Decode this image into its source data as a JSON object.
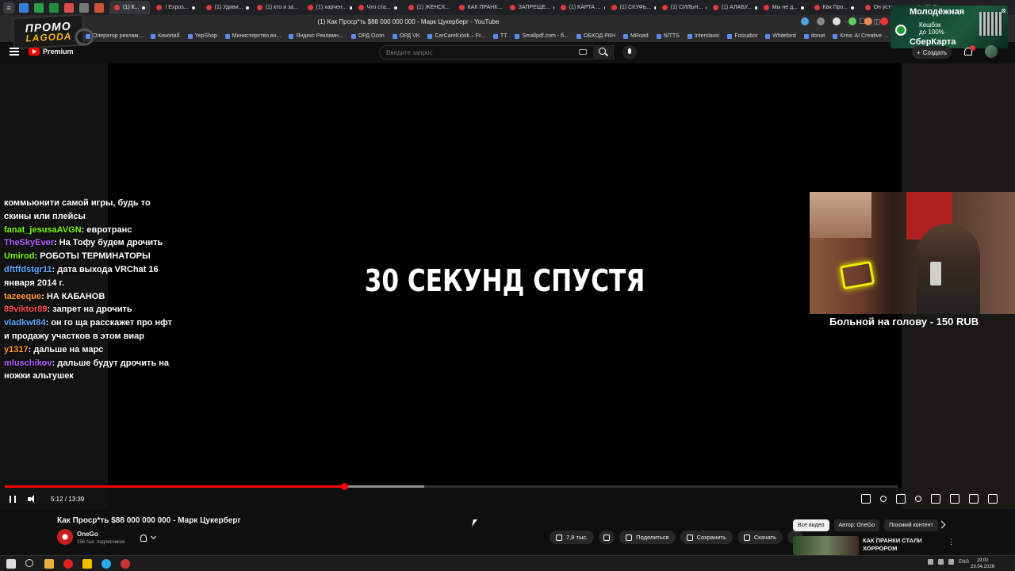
{
  "browser": {
    "window_title": "(1) Как Проср*ть $88 000 000 000 - Марк Цукерберг - YouTube",
    "tabs": [
      {
        "label": "(1) К...",
        "active": true
      },
      {
        "label": "! Expos...",
        "active": false
      },
      {
        "label": "(1) Удиви...",
        "active": false
      },
      {
        "label": "(1) кто и за...",
        "active": false
      },
      {
        "label": "(1) харчен...",
        "active": false
      },
      {
        "label": "Что ста...",
        "active": false
      },
      {
        "label": "(1) ЖЕНСК...",
        "active": false
      },
      {
        "label": "КАК ПРАНК...",
        "active": false
      },
      {
        "label": "ЗАПРЕЩЕ...",
        "active": false
      },
      {
        "label": "(1) КАРТА ...",
        "active": false
      },
      {
        "label": "(1) СКУФЬ...",
        "active": false
      },
      {
        "label": "(1) СИЛЬН...",
        "active": false
      },
      {
        "label": "(1) АЛАБУ...",
        "active": false
      },
      {
        "label": "Мы не д...",
        "active": false
      },
      {
        "label": "Как Про...",
        "active": false
      },
      {
        "label": "Он устр...",
        "active": false
      },
      {
        "label": "(1) Я стал...",
        "active": false
      }
    ],
    "bookmarks": [
      "Оператор реклам...",
      "Кинопаб",
      "YepShop",
      "Министерство вн...",
      "Яндекс Рекламн...",
      "ОРД Ozon",
      "ОРД VK",
      "CarCareKiosk – Fr...",
      "TT",
      "Smallpdf.com - б...",
      "ОБХОД РКН",
      "MRoad",
      "N/TTS",
      "Interslavic",
      "Fossabot",
      "Whitebird",
      "donat",
      "Krea: AI Creative ...",
      "хсобалы"
    ]
  },
  "overlay_promo": {
    "line1": "ПРОМО",
    "line2": "LAGODA"
  },
  "overlay_ad": {
    "title": "Молодёжная",
    "line1": "Кешбэк",
    "line2": "до 100%",
    "brand": "СберКарта"
  },
  "youtube": {
    "premium_label": "Premium",
    "search_placeholder": "Введите запрос",
    "create_label": "Создать"
  },
  "player": {
    "caption": "30 СЕКУНД СПУСТЯ",
    "time": "5:12 / 13:39",
    "progress_played_fraction": 0.38,
    "progress_loaded_fraction": 0.47
  },
  "stream_chat": [
    {
      "user": "",
      "color": "#ffffff",
      "text": "коммьюнити самой игры, будь то скины или плейсы"
    },
    {
      "user": "fanat_jesusaAVGN",
      "color": "#7cfc00",
      "text": "евротранс"
    },
    {
      "user": "TheSkyEver",
      "color": "#b45cff",
      "text": "На Тофу будем дрочить"
    },
    {
      "user": "Umirod",
      "color": "#7cfc00",
      "text": "РОБОТЫ ТЕРМИНАТОРЫ"
    },
    {
      "user": "dftffdstgr11",
      "color": "#5fa8ff",
      "text": "дата выхода VRChat 16 января 2014 г."
    },
    {
      "user": "tazeeque",
      "color": "#ff9a2e",
      "text": "НА КАБАНОВ"
    },
    {
      "user": "89viktor89",
      "color": "#ff4d4d",
      "text": "запрет на дрочить"
    },
    {
      "user": "vladkwt84",
      "color": "#5fa8ff",
      "text": "он го ща расскажет про нфт и продажу участков в этом виар"
    },
    {
      "user": "y1317",
      "color": "#ff9a2e",
      "text": "дальше на марс"
    },
    {
      "user": "mluschikov",
      "color": "#b45cff",
      "text": "дальше будут дрочить на ножки альтушек"
    }
  ],
  "donation": "Больной на голову - 150 RUB",
  "video": {
    "title": "Как Проср*ть $88 000 000 000 - Марк Цукерберг",
    "channel": "OneGo",
    "subscribers": "156 тыс. подписчиков",
    "likes": "7,8 тыс.",
    "share_label": "Поделиться",
    "save_label": "Сохранить",
    "download_label": "Скачать"
  },
  "recommendations": {
    "chips": [
      "Все видео",
      "Автор: OneGo",
      "Похожий контент"
    ],
    "first_title": "КАК ПРАНКИ СТАЛИ ХОРРОРОМ"
  },
  "taskbar": {
    "lang": "ENG",
    "time": "19:00",
    "date": "29.04.2026"
  }
}
